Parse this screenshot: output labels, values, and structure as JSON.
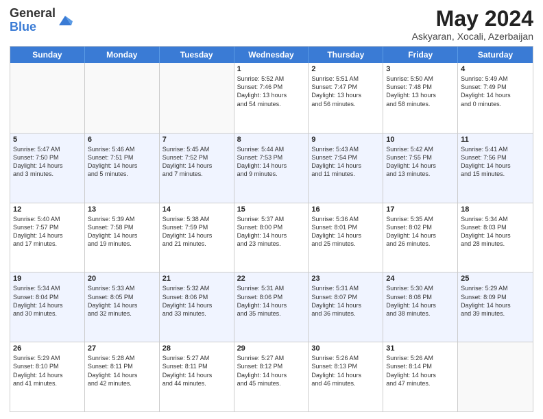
{
  "logo": {
    "general": "General",
    "blue": "Blue"
  },
  "title": "May 2024",
  "location": "Askyaran, Xocali, Azerbaijan",
  "weekdays": [
    "Sunday",
    "Monday",
    "Tuesday",
    "Wednesday",
    "Thursday",
    "Friday",
    "Saturday"
  ],
  "rows": [
    [
      {
        "day": "",
        "info": ""
      },
      {
        "day": "",
        "info": ""
      },
      {
        "day": "",
        "info": ""
      },
      {
        "day": "1",
        "info": "Sunrise: 5:52 AM\nSunset: 7:46 PM\nDaylight: 13 hours\nand 54 minutes."
      },
      {
        "day": "2",
        "info": "Sunrise: 5:51 AM\nSunset: 7:47 PM\nDaylight: 13 hours\nand 56 minutes."
      },
      {
        "day": "3",
        "info": "Sunrise: 5:50 AM\nSunset: 7:48 PM\nDaylight: 13 hours\nand 58 minutes."
      },
      {
        "day": "4",
        "info": "Sunrise: 5:49 AM\nSunset: 7:49 PM\nDaylight: 14 hours\nand 0 minutes."
      }
    ],
    [
      {
        "day": "5",
        "info": "Sunrise: 5:47 AM\nSunset: 7:50 PM\nDaylight: 14 hours\nand 3 minutes."
      },
      {
        "day": "6",
        "info": "Sunrise: 5:46 AM\nSunset: 7:51 PM\nDaylight: 14 hours\nand 5 minutes."
      },
      {
        "day": "7",
        "info": "Sunrise: 5:45 AM\nSunset: 7:52 PM\nDaylight: 14 hours\nand 7 minutes."
      },
      {
        "day": "8",
        "info": "Sunrise: 5:44 AM\nSunset: 7:53 PM\nDaylight: 14 hours\nand 9 minutes."
      },
      {
        "day": "9",
        "info": "Sunrise: 5:43 AM\nSunset: 7:54 PM\nDaylight: 14 hours\nand 11 minutes."
      },
      {
        "day": "10",
        "info": "Sunrise: 5:42 AM\nSunset: 7:55 PM\nDaylight: 14 hours\nand 13 minutes."
      },
      {
        "day": "11",
        "info": "Sunrise: 5:41 AM\nSunset: 7:56 PM\nDaylight: 14 hours\nand 15 minutes."
      }
    ],
    [
      {
        "day": "12",
        "info": "Sunrise: 5:40 AM\nSunset: 7:57 PM\nDaylight: 14 hours\nand 17 minutes."
      },
      {
        "day": "13",
        "info": "Sunrise: 5:39 AM\nSunset: 7:58 PM\nDaylight: 14 hours\nand 19 minutes."
      },
      {
        "day": "14",
        "info": "Sunrise: 5:38 AM\nSunset: 7:59 PM\nDaylight: 14 hours\nand 21 minutes."
      },
      {
        "day": "15",
        "info": "Sunrise: 5:37 AM\nSunset: 8:00 PM\nDaylight: 14 hours\nand 23 minutes."
      },
      {
        "day": "16",
        "info": "Sunrise: 5:36 AM\nSunset: 8:01 PM\nDaylight: 14 hours\nand 25 minutes."
      },
      {
        "day": "17",
        "info": "Sunrise: 5:35 AM\nSunset: 8:02 PM\nDaylight: 14 hours\nand 26 minutes."
      },
      {
        "day": "18",
        "info": "Sunrise: 5:34 AM\nSunset: 8:03 PM\nDaylight: 14 hours\nand 28 minutes."
      }
    ],
    [
      {
        "day": "19",
        "info": "Sunrise: 5:34 AM\nSunset: 8:04 PM\nDaylight: 14 hours\nand 30 minutes."
      },
      {
        "day": "20",
        "info": "Sunrise: 5:33 AM\nSunset: 8:05 PM\nDaylight: 14 hours\nand 32 minutes."
      },
      {
        "day": "21",
        "info": "Sunrise: 5:32 AM\nSunset: 8:06 PM\nDaylight: 14 hours\nand 33 minutes."
      },
      {
        "day": "22",
        "info": "Sunrise: 5:31 AM\nSunset: 8:06 PM\nDaylight: 14 hours\nand 35 minutes."
      },
      {
        "day": "23",
        "info": "Sunrise: 5:31 AM\nSunset: 8:07 PM\nDaylight: 14 hours\nand 36 minutes."
      },
      {
        "day": "24",
        "info": "Sunrise: 5:30 AM\nSunset: 8:08 PM\nDaylight: 14 hours\nand 38 minutes."
      },
      {
        "day": "25",
        "info": "Sunrise: 5:29 AM\nSunset: 8:09 PM\nDaylight: 14 hours\nand 39 minutes."
      }
    ],
    [
      {
        "day": "26",
        "info": "Sunrise: 5:29 AM\nSunset: 8:10 PM\nDaylight: 14 hours\nand 41 minutes."
      },
      {
        "day": "27",
        "info": "Sunrise: 5:28 AM\nSunset: 8:11 PM\nDaylight: 14 hours\nand 42 minutes."
      },
      {
        "day": "28",
        "info": "Sunrise: 5:27 AM\nSunset: 8:11 PM\nDaylight: 14 hours\nand 44 minutes."
      },
      {
        "day": "29",
        "info": "Sunrise: 5:27 AM\nSunset: 8:12 PM\nDaylight: 14 hours\nand 45 minutes."
      },
      {
        "day": "30",
        "info": "Sunrise: 5:26 AM\nSunset: 8:13 PM\nDaylight: 14 hours\nand 46 minutes."
      },
      {
        "day": "31",
        "info": "Sunrise: 5:26 AM\nSunset: 8:14 PM\nDaylight: 14 hours\nand 47 minutes."
      },
      {
        "day": "",
        "info": ""
      }
    ]
  ],
  "alt_rows": [
    1,
    3
  ]
}
